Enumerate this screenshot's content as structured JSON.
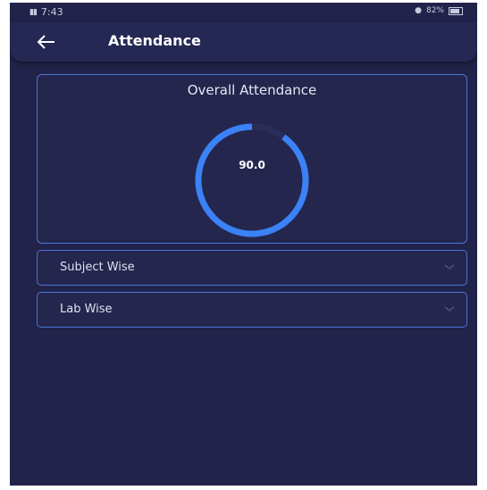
{
  "status_bar": {
    "time": "7:43",
    "right_text": "82%"
  },
  "app_bar": {
    "back_icon": "arrow-left-icon",
    "title": "Attendance"
  },
  "overall": {
    "title": "Overall Attendance",
    "value_label": "90.0",
    "percent": 90.0
  },
  "sections": [
    {
      "label": "Subject Wise",
      "icon": "chevron-down-icon"
    },
    {
      "label": "Lab Wise",
      "icon": "chevron-down-icon"
    }
  ],
  "colors": {
    "background": "#21234a",
    "accent": "#3b82f6",
    "border": "#4a74d4",
    "track": "#2a2d58"
  }
}
